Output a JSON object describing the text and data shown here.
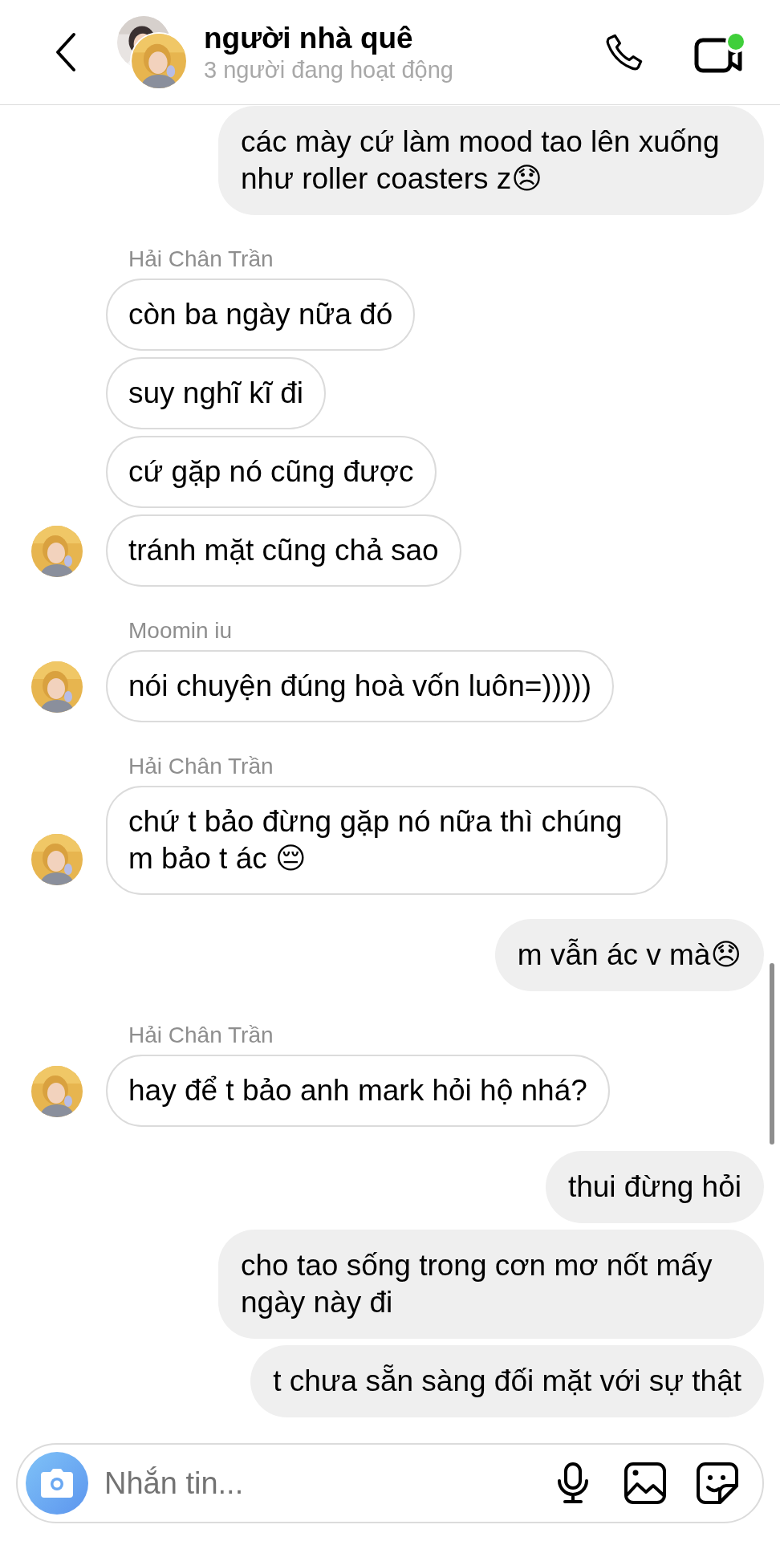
{
  "header": {
    "title": "người nhà quê",
    "subtitle": "3 người đang hoạt động"
  },
  "messages": [
    {
      "kind": "sent",
      "text": "các mày cứ làm mood tao lên xuống như roller coasters z😞"
    },
    {
      "kind": "name",
      "text": "Hải Chân Trần"
    },
    {
      "kind": "received",
      "text": "còn ba ngày nữa đó",
      "avatar": false
    },
    {
      "kind": "received",
      "text": "suy nghĩ kĩ đi",
      "avatar": false
    },
    {
      "kind": "received",
      "text": "cứ gặp nó cũng được",
      "avatar": false
    },
    {
      "kind": "received",
      "text": "tránh mặt cũng chả sao",
      "avatar": true
    },
    {
      "kind": "name",
      "text": "Moomin iu"
    },
    {
      "kind": "received",
      "text": "nói chuyện đúng hoà vốn luôn=)))))",
      "avatar": true
    },
    {
      "kind": "name",
      "text": "Hải Chân Trần"
    },
    {
      "kind": "received",
      "text": "chứ t bảo đừng gặp nó nữa thì chúng m bảo t ác 😔",
      "avatar": true
    },
    {
      "kind": "sent",
      "text": "m vẫn ác v mà😞"
    },
    {
      "kind": "name",
      "text": "Hải Chân Trần"
    },
    {
      "kind": "received",
      "text": "hay để t bảo anh mark hỏi hộ nhá?",
      "avatar": true
    },
    {
      "kind": "sent",
      "text": "thui đừng hỏi"
    },
    {
      "kind": "sent",
      "text": "cho tao sống trong cơn mơ nốt mấy ngày này đi"
    },
    {
      "kind": "sent",
      "text": "t chưa sẵn sàng đối mặt với sự thật"
    }
  ],
  "composer": {
    "placeholder": "Nhắn tin..."
  }
}
